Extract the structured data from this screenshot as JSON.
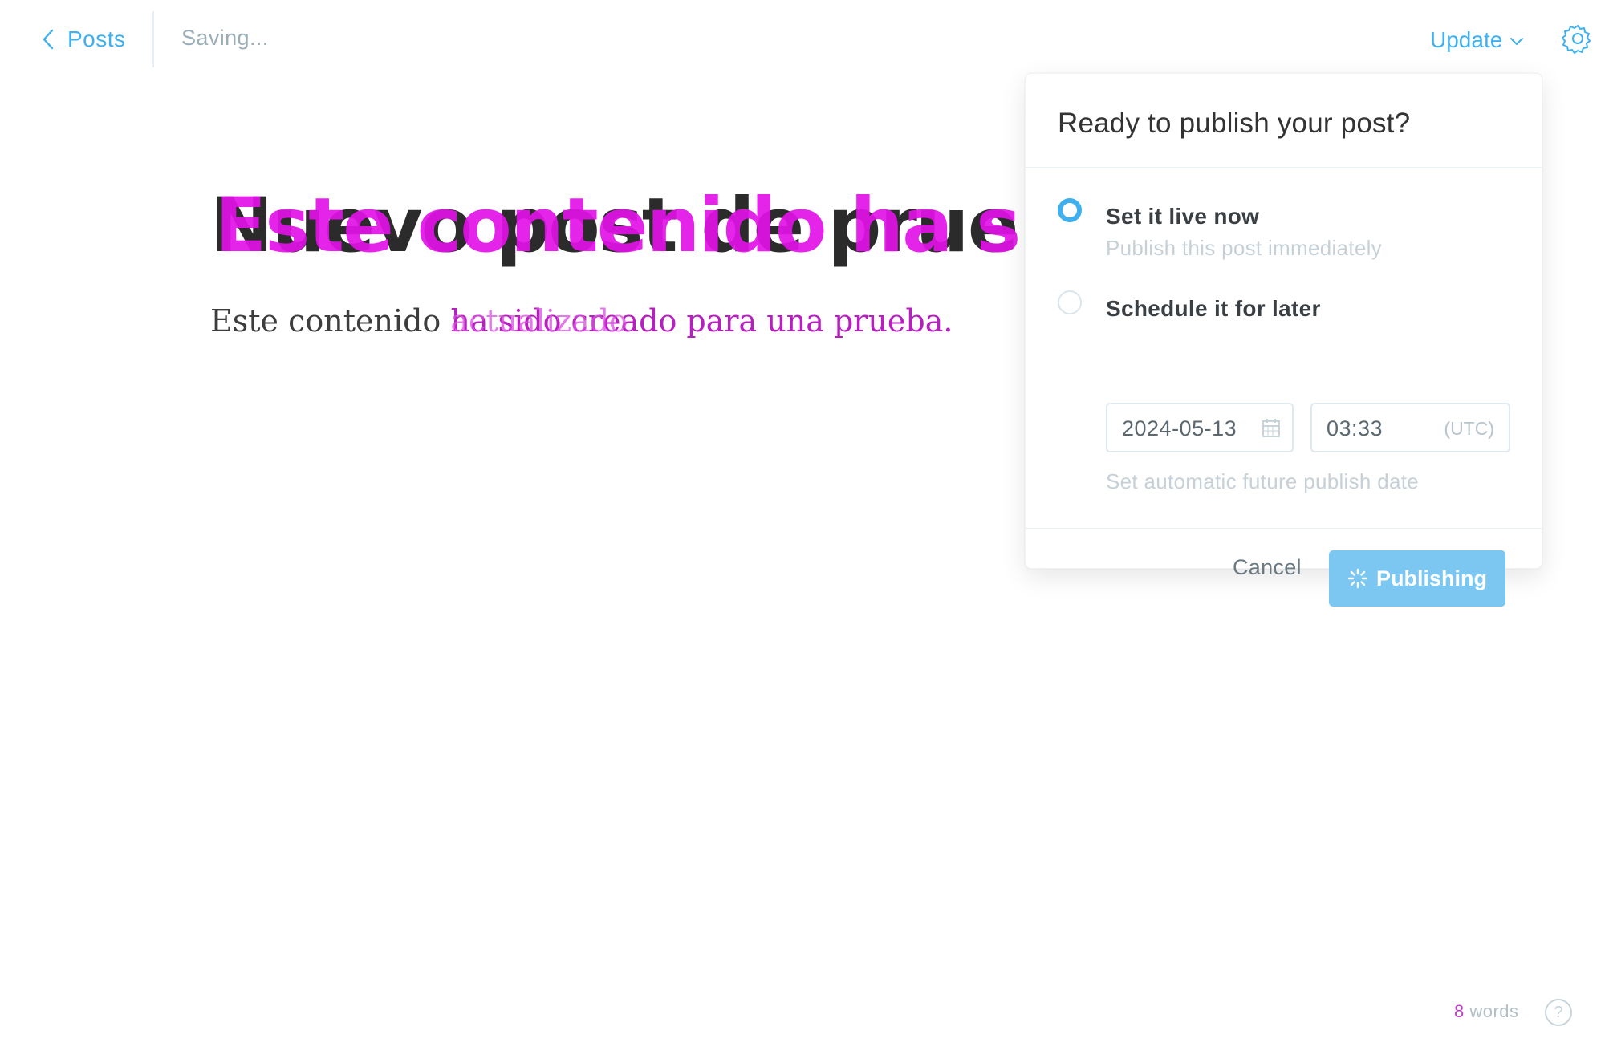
{
  "topbar": {
    "back_label": "Posts",
    "status_text": "Saving...",
    "update_label": "Update"
  },
  "editor": {
    "title_text": "Nuevo post de prueba",
    "title_ghost_text": "Este contenido ha sido",
    "body_stable": "Este contenido ",
    "body_text": "ha sido creado para una prueba.",
    "body_ghost": "actualizado"
  },
  "publish_menu": {
    "title": "Ready to publish your post?",
    "option_now_label": "Set it live now",
    "option_now_desc": "Publish this post immediately",
    "option_later_label": "Schedule it for later",
    "date_value": "2024-05-13",
    "time_value": "03:33",
    "timezone_label": "(UTC)",
    "schedule_hint": "Set automatic future publish date",
    "cancel_label": "Cancel",
    "publish_label": "Publishing",
    "selected_option": "now"
  },
  "footer": {
    "word_count": "8",
    "word_label": " words",
    "help_label": "?"
  },
  "colors": {
    "accent": "#3eb0ef",
    "publish_button": "#7cc7f1",
    "muted_text": "#9baeb8"
  }
}
